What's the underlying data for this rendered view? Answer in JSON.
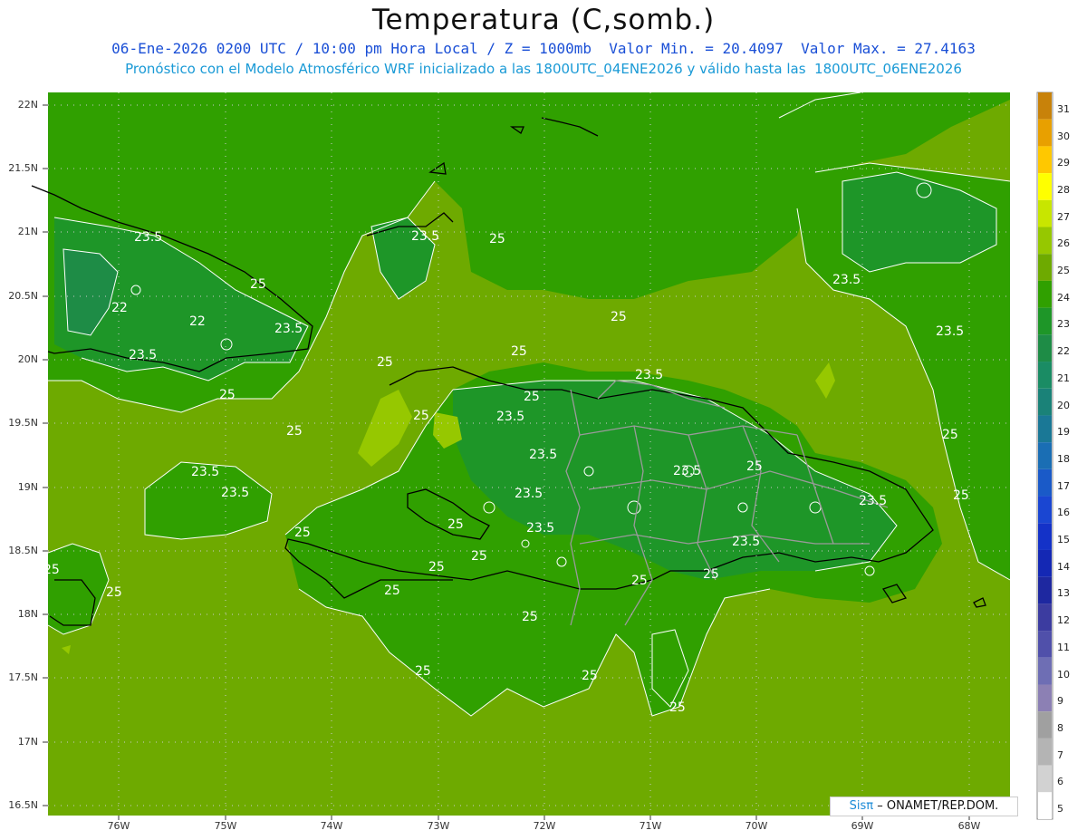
{
  "header": {
    "title": "Temperatura (C,somb.)",
    "subtitle1": "06-Ene-2026 0200 UTC / 10:00 pm Hora Local / Z = 1000mb  Valor Min. = 20.4097  Valor Max. = 27.4163",
    "subtitle2": "Pronóstico con el Modelo Atmosférico WRF inicializado a las 1800UTC_04ENE2026 y válido hasta las  1800UTC_06ENE2026"
  },
  "axes": {
    "lat_labels": [
      "22N",
      "21.5N",
      "21N",
      "20.5N",
      "20N",
      "19.5N",
      "19N",
      "18.5N",
      "18N",
      "17.5N",
      "17N",
      "16.5N"
    ],
    "lon_labels": [
      "76W",
      "75W",
      "74W",
      "73W",
      "72W",
      "71W",
      "70W",
      "69W",
      "68W"
    ]
  },
  "colorbar": {
    "labels": [
      "31",
      "30",
      "29",
      "28",
      "27",
      "26",
      "25",
      "24",
      "23",
      "22",
      "21",
      "20",
      "19",
      "18",
      "17",
      "16",
      "15",
      "14",
      "13",
      "12",
      "11",
      "10",
      "9",
      "8",
      "7",
      "6",
      "5"
    ],
    "colors": [
      "#c8820a",
      "#e8a000",
      "#ffc800",
      "#ffff00",
      "#c8e600",
      "#96c800",
      "#6eaa00",
      "#30a000",
      "#1e9628",
      "#1e8c46",
      "#1a8c64",
      "#1a8278",
      "#1a7896",
      "#1a6eb4",
      "#1a5ac8",
      "#1a46d2",
      "#1432c8",
      "#1428b4",
      "#1e28a0",
      "#3c3ca0",
      "#5050aa",
      "#6e6eb4",
      "#8c80b4",
      "#a0a0a0",
      "#b4b4b4",
      "#d2d2d2",
      "#ffffff"
    ]
  },
  "contour_labels": [
    "23.5",
    "25",
    "22",
    "23.5",
    "22",
    "25",
    "23.5",
    "25",
    "23.5",
    "25",
    "25",
    "25",
    "25",
    "23.5",
    "23.5",
    "25",
    "23.5",
    "25",
    "23.5",
    "23.5",
    "23.5",
    "23.5",
    "23.5",
    "25",
    "23.5",
    "25",
    "23.5",
    "25",
    "25",
    "25",
    "25",
    "25",
    "23.5",
    "23.5",
    "25",
    "25",
    "25",
    "25",
    "25"
  ],
  "colors": {
    "background_green": "#6eaa00",
    "land_green": "#30a000",
    "cool_green": "#1e9628",
    "coolest_green": "#1e8c46",
    "warm_green": "#96c800",
    "credit_accent": "#1a8ad6"
  },
  "credit": {
    "brand": "Sisπ",
    "text": "– ONAMET/REP.DOM."
  }
}
